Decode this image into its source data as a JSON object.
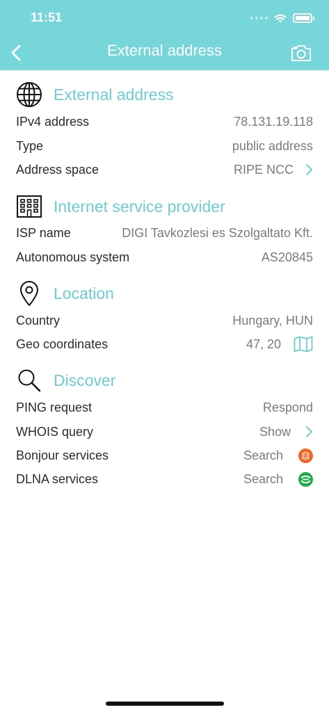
{
  "status_bar": {
    "time": "11:51"
  },
  "nav": {
    "title": "External address"
  },
  "sections": {
    "external": {
      "title": "External address",
      "rows": [
        {
          "label": "IPv4 address",
          "value": "78.131.19.118"
        },
        {
          "label": "Type",
          "value": "public address"
        },
        {
          "label": "Address space",
          "value": "RIPE NCC"
        }
      ]
    },
    "isp": {
      "title": "Internet service provider",
      "rows": [
        {
          "label": "ISP name",
          "value": "DIGI Tavkozlesi es Szolgaltato Kft."
        },
        {
          "label": "Autonomous system",
          "value": "AS20845"
        }
      ]
    },
    "location": {
      "title": "Location",
      "rows": [
        {
          "label": "Country",
          "value": "Hungary, HUN"
        },
        {
          "label": "Geo coordinates",
          "value": "47, 20"
        }
      ]
    },
    "discover": {
      "title": "Discover",
      "rows": [
        {
          "label": "PING request",
          "value": "Respond"
        },
        {
          "label": "WHOIS query",
          "value": "Show"
        },
        {
          "label": "Bonjour services",
          "value": "Search"
        },
        {
          "label": "DLNA services",
          "value": "Search"
        }
      ]
    }
  },
  "colors": {
    "header_bg": "#76d6d9",
    "accent": "#6dcdd1",
    "bonjour_badge": "#f26522",
    "dlna_badge": "#1faa4a"
  },
  "icons": {
    "back": "chevron-left-icon",
    "camera": "camera-icon",
    "external": "globe-icon",
    "isp": "building-icon",
    "location": "map-pin-icon",
    "discover": "magnifier-icon",
    "address_space": "chevron-right-icon",
    "geo": "map-icon",
    "whois": "chevron-right-icon",
    "bonjour": "bonjour-icon",
    "dlna": "dlna-icon"
  }
}
